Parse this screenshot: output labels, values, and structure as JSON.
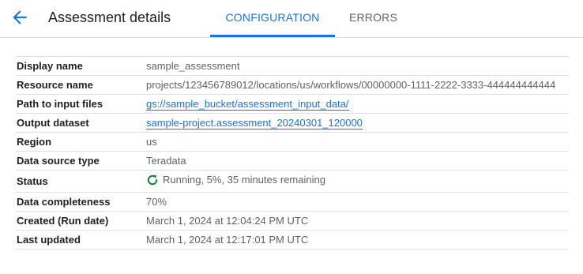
{
  "header": {
    "title": "Assessment details",
    "back_icon": "arrow-back-icon"
  },
  "tabs": [
    {
      "label": "CONFIGURATION",
      "active": true
    },
    {
      "label": "ERRORS",
      "active": false
    }
  ],
  "colors": {
    "accent": "#1a73e8",
    "status_running": "#188038"
  },
  "details": {
    "display_name": {
      "label": "Display name",
      "value": "sample_assessment"
    },
    "resource_name": {
      "label": "Resource name",
      "value": "projects/123456789012/locations/us/workflows/00000000-1111-2222-3333-444444444444"
    },
    "path_to_input": {
      "label": "Path to input files",
      "value": "gs://sample_bucket/assessment_input_data/"
    },
    "output_dataset": {
      "label": "Output dataset",
      "value": "sample-project.assessment_20240301_120000"
    },
    "region": {
      "label": "Region",
      "value": "us"
    },
    "data_source_type": {
      "label": "Data source type",
      "value": "Teradata"
    },
    "status": {
      "label": "Status",
      "value": "Running, 5%, 35 minutes remaining",
      "icon": "running-status-icon"
    },
    "data_completeness": {
      "label": "Data completeness",
      "value": "70%"
    },
    "created": {
      "label": "Created (Run date)",
      "value": "March 1, 2024 at 12:04:24 PM UTC"
    },
    "last_updated": {
      "label": "Last updated",
      "value": "March 1, 2024 at 12:17:01 PM UTC"
    }
  }
}
